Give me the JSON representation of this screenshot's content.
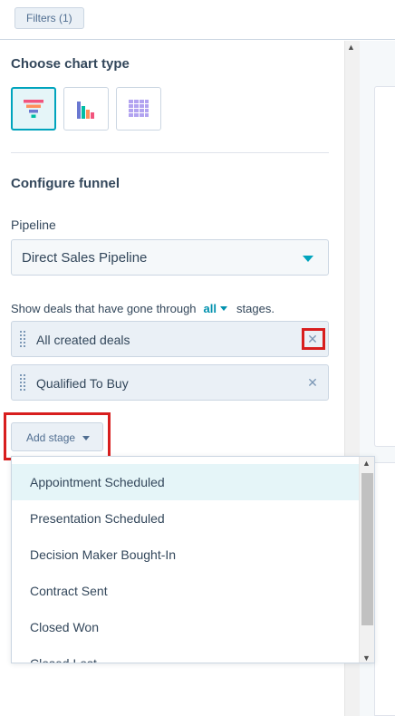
{
  "topbar": {
    "filters_label": "Filters (1)"
  },
  "chart_type": {
    "title": "Choose chart type",
    "options": [
      {
        "icon": "funnel-chart-icon",
        "selected": true
      },
      {
        "icon": "bar-chart-icon",
        "selected": false
      },
      {
        "icon": "table-chart-icon",
        "selected": false
      }
    ]
  },
  "configure": {
    "title": "Configure funnel",
    "pipeline_label": "Pipeline",
    "pipeline_value": "Direct Sales Pipeline",
    "show_text_before": "Show deals that have gone through",
    "show_mode": "all",
    "show_text_after": "stages.",
    "stages": [
      {
        "label": "All created deals",
        "remove_icon": "close-icon"
      },
      {
        "label": "Qualified To Buy",
        "remove_icon": "close-icon"
      }
    ],
    "add_stage_label": "Add stage"
  },
  "dropdown": {
    "items": [
      "Appointment Scheduled",
      "Presentation Scheduled",
      "Decision Maker Bought-In",
      "Contract Sent",
      "Closed Won",
      "Closed Lost"
    ],
    "active_index": 0
  },
  "colors": {
    "accent": "#00a4bd",
    "highlight": "#d81e1e",
    "text": "#33475b"
  }
}
